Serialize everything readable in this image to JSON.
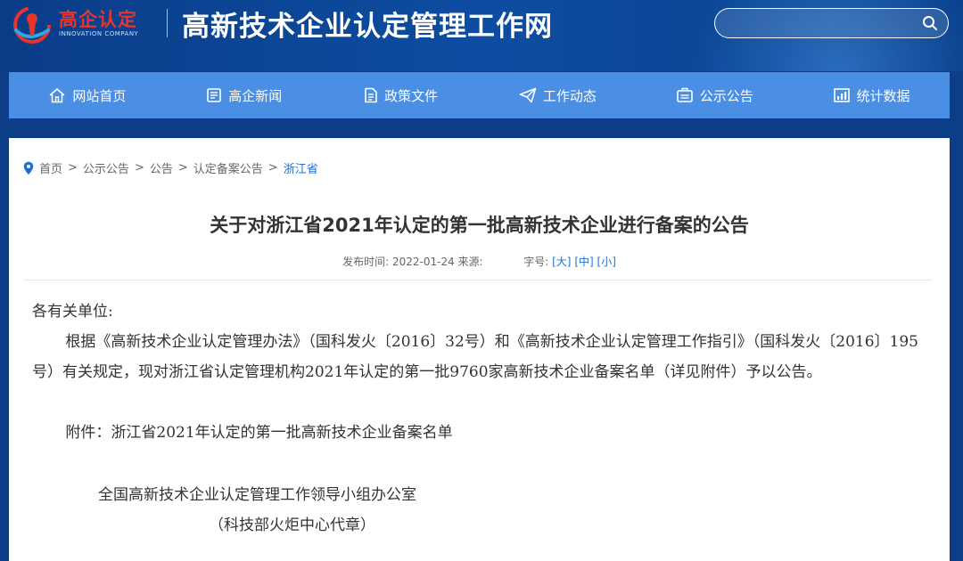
{
  "header": {
    "logo_text": "高企认定",
    "logo_subtext": "INNOVATION COMPANY",
    "site_title": "高新技术企业认定管理工作网",
    "search": {
      "placeholder": "",
      "icon": "search-icon"
    }
  },
  "nav": {
    "items": [
      {
        "label": "网站首页",
        "icon": "home-icon"
      },
      {
        "label": "高企新闻",
        "icon": "news-icon"
      },
      {
        "label": "政策文件",
        "icon": "document-icon"
      },
      {
        "label": "工作动态",
        "icon": "paper-plane-icon"
      },
      {
        "label": "公示公告",
        "icon": "announcement-icon"
      },
      {
        "label": "统计数据",
        "icon": "chart-icon"
      }
    ]
  },
  "breadcrumb": {
    "icon": "location-pin-icon",
    "items": [
      "首页",
      "公示公告",
      "公告",
      "认定备案公告",
      "浙江省"
    ],
    "separator": ">"
  },
  "article": {
    "title": "关于对浙江省2021年认定的第一批高新技术企业进行备案的公告",
    "publish_label": "发布时间:",
    "publish_date": "2022-01-24",
    "source_label": "来源:",
    "font_size_label": "字号:",
    "font_sizes": [
      "[大]",
      "[中]",
      "[小]"
    ],
    "salutation": "各有关单位:",
    "paragraph": "根据《高新技术企业认定管理办法》（国科发火〔2016〕32号）和《高新技术企业认定管理工作指引》（国科发火〔2016〕195号）有关规定，现对浙江省认定管理机构2021年认定的第一批9760家高新技术企业备案名单（详见附件）予以公告。",
    "attachment": "附件：浙江省2021年认定的第一批高新技术企业备案名单",
    "signature_org": "全国高新技术企业认定管理工作领导小组办公室",
    "signature_note": "（科技部火炬中心代章）"
  },
  "colors": {
    "header_bg": "#0b3e86",
    "nav_bg": "#4a8fe4",
    "accent": "#1f6fd0",
    "logo_red": "#e8342c"
  }
}
